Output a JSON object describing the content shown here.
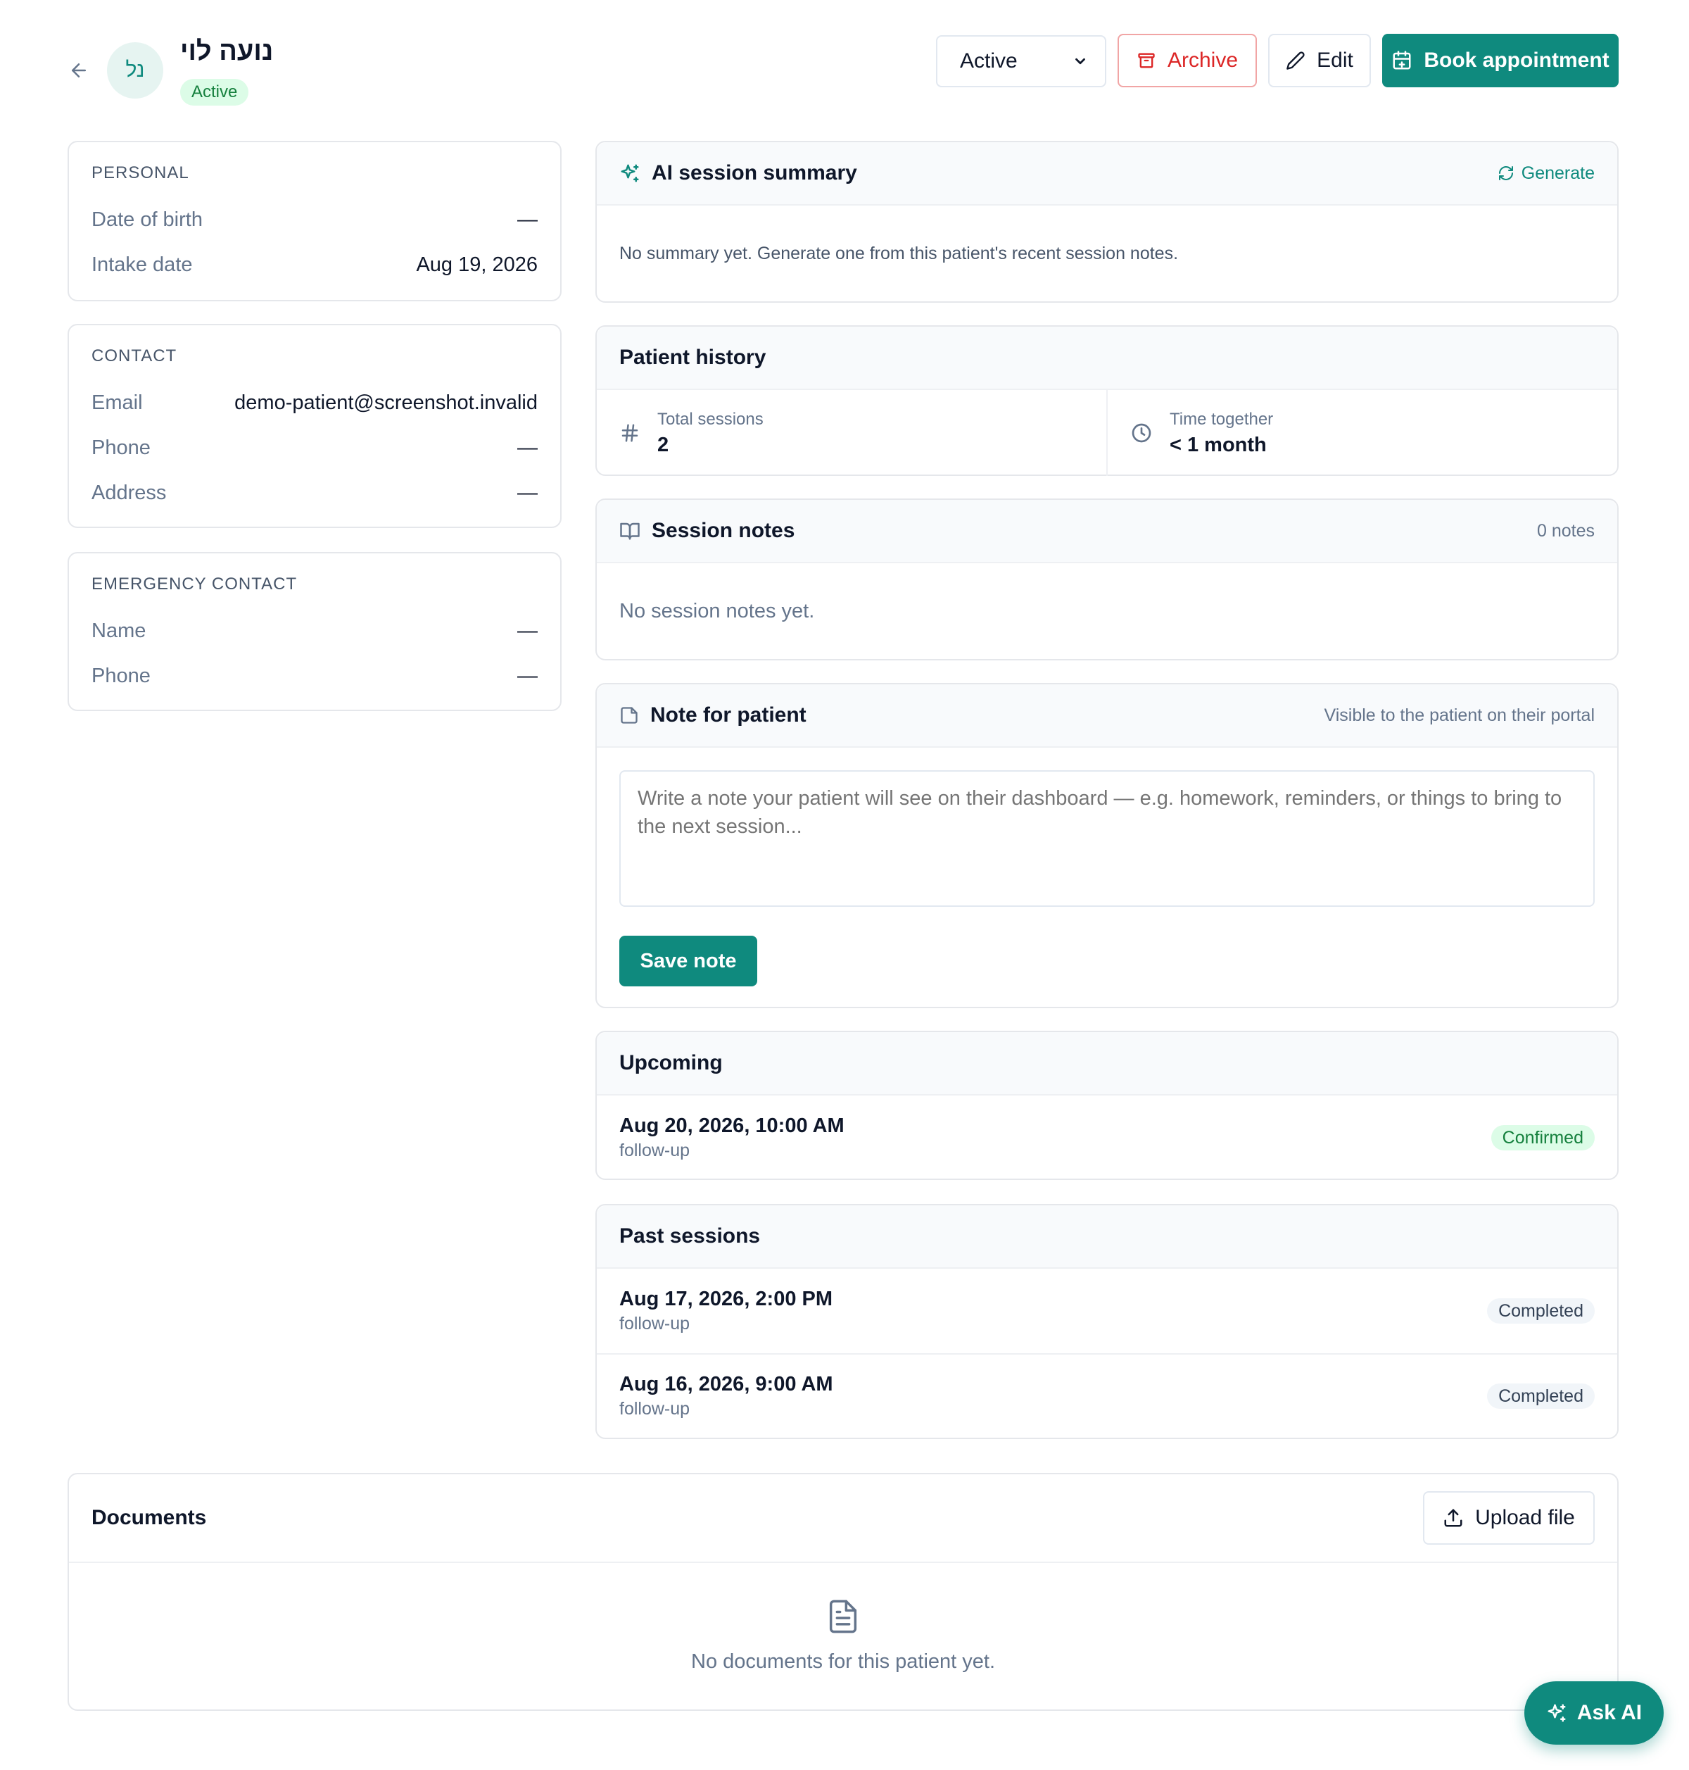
{
  "header": {
    "patient_name": "נועה לוי",
    "avatar_initials": "נל",
    "status": "Active",
    "status_select": {
      "selected": "Active"
    },
    "archive_label": "Archive",
    "edit_label": "Edit",
    "book_label": "Book appointment"
  },
  "personal": {
    "title": "PERSONAL",
    "fields": [
      {
        "label": "Date of birth",
        "value": "—"
      },
      {
        "label": "Intake date",
        "value": "Aug 19, 2026"
      }
    ]
  },
  "contact": {
    "title": "CONTACT",
    "fields": [
      {
        "label": "Email",
        "value": "demo-patient@screenshot.invalid"
      },
      {
        "label": "Phone",
        "value": "—"
      },
      {
        "label": "Address",
        "value": "—"
      }
    ]
  },
  "emergency": {
    "title": "EMERGENCY CONTACT",
    "fields": [
      {
        "label": "Name",
        "value": "—"
      },
      {
        "label": "Phone",
        "value": "—"
      }
    ]
  },
  "ai_summary": {
    "title": "AI session summary",
    "generate_label": "Generate",
    "empty_text": "No summary yet. Generate one from this patient's recent session notes."
  },
  "history": {
    "title": "Patient history",
    "total_sessions_label": "Total sessions",
    "total_sessions_value": "2",
    "time_together_label": "Time together",
    "time_together_value": "< 1 month"
  },
  "session_notes": {
    "title": "Session notes",
    "count": "0 notes",
    "empty_text": "No session notes yet."
  },
  "patient_note": {
    "title": "Note for patient",
    "visibility": "Visible to the patient on their portal",
    "placeholder": "Write a note your patient will see on their dashboard — e.g. homework, reminders, or things to bring to the next session...",
    "save_label": "Save note"
  },
  "upcoming": {
    "title": "Upcoming",
    "items": [
      {
        "time": "Aug 20, 2026, 10:00 AM",
        "type": "follow-up",
        "status": "Confirmed"
      }
    ]
  },
  "past": {
    "title": "Past sessions",
    "items": [
      {
        "time": "Aug 17, 2026, 2:00 PM",
        "type": "follow-up",
        "status": "Completed"
      },
      {
        "time": "Aug 16, 2026, 9:00 AM",
        "type": "follow-up",
        "status": "Completed"
      }
    ]
  },
  "documents": {
    "title": "Documents",
    "upload_label": "Upload file",
    "empty_text": "No documents for this patient yet."
  },
  "ask_ai_label": "Ask AI",
  "colors": {
    "accent": "#0f8a7e",
    "danger": "#dc2626",
    "success_bg": "#dcfce7",
    "success_text": "#15803d"
  }
}
